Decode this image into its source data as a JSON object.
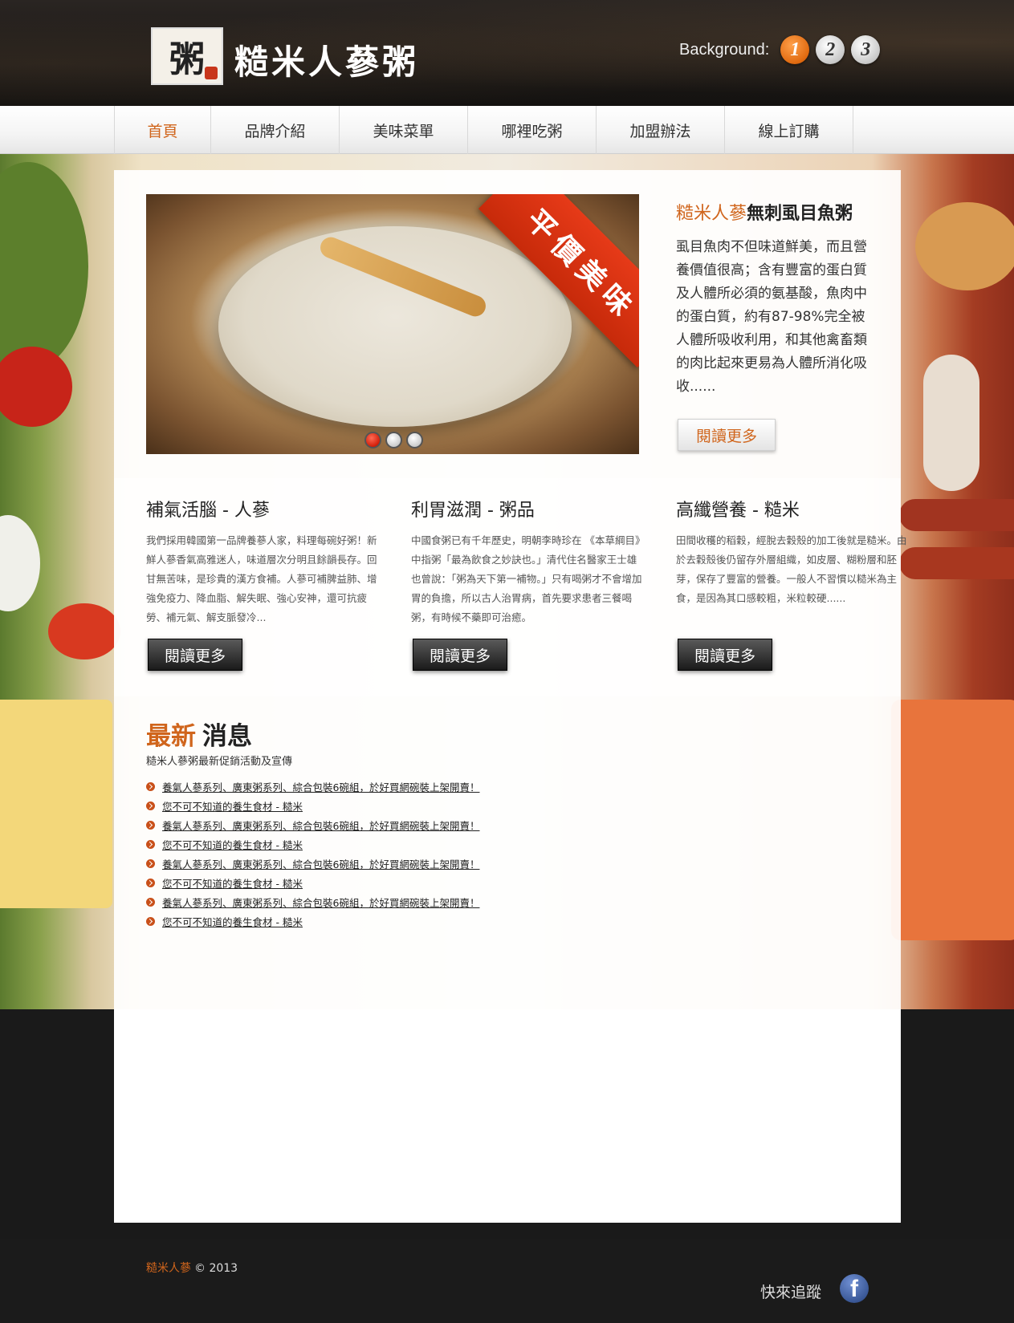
{
  "header": {
    "logo_glyph": "粥",
    "brand": "糙米人蔘粥",
    "background_label": "Background:",
    "background_options": [
      "1",
      "2",
      "3"
    ]
  },
  "nav": {
    "items": [
      "首頁",
      "品牌介紹",
      "美味菜單",
      "哪裡吃粥",
      "加盟辦法",
      "線上訂購"
    ]
  },
  "slider": {
    "ribbon": "平價美味"
  },
  "feature": {
    "title_accent": "糙米人蔘",
    "title_rest": "無刺虱目魚粥",
    "body": "虱目魚肉不但味道鮮美，而且營養價值很高；含有豐富的蛋白質及人體所必須的氨基酸，魚肉中的蛋白質，約有87-98%完全被人體所吸收利用，和其他禽畜類的肉比起來更易為人體所消化吸收......",
    "button": "閱讀更多"
  },
  "columns": [
    {
      "title": "補氣活腦 - 人蔘",
      "body": "我們採用韓國第一品牌養蔘人家，料理每碗好粥！新鮮人蔘香氣高雅迷人，味道層次分明且餘韻長存。回甘無苦味，是珍貴的漢方食補。人蔘可補脾益肺、增強免疫力、降血脂、解失眠、強心安神，還可抗疲勞、補元氣、解支脈發冷...",
      "button": "閱讀更多"
    },
    {
      "title": "利胃滋潤 - 粥品",
      "body": "中國食粥已有千年歷史，明朝李時珍在 《本草綱目》中指粥「最為飲食之妙訣也。」清代住名醫家王士雄也曾說：「粥為天下第一補物。」只有喝粥才不會增加胃的負擔，所以古人治胃病，首先要求患者三餐喝粥，有時候不藥即可治癒。",
      "button": "閱讀更多"
    },
    {
      "title": "高纖營養 - 糙米",
      "body": "田間收穫的稻穀，經脫去穀殼的加工後就是糙米。由於去穀殼後仍留存外層組織，如皮層、糊粉層和胚芽，保存了豐富的營養。一般人不習慣以糙米為主食，是因為其口感較粗，米粒較硬......",
      "button": "閱讀更多"
    }
  ],
  "news": {
    "title_accent": "最新",
    "title_rest": "消息",
    "subtitle": "糙米人蔘粥最新促銷活動及宣傳",
    "items": [
      "養氣人蔘系列、廣東粥系列、綜合包裝6碗組，於好買網碗裝上架開賣！",
      "您不可不知道的養生食材 - 糙米",
      "養氣人蔘系列、廣東粥系列、綜合包裝6碗組，於好買網碗裝上架開賣！",
      "您不可不知道的養生食材 - 糙米",
      "養氣人蔘系列、廣東粥系列、綜合包裝6碗組，於好買網碗裝上架開賣！",
      "您不可不知道的養生食材 - 糙米",
      "養氣人蔘系列、廣東粥系列、綜合包裝6碗組，於好買網碗裝上架開賣！",
      "您不可不知道的養生食材 - 糙米"
    ]
  },
  "footer": {
    "brand": "糙米人蔘",
    "copyright": "© 2013",
    "follow": "快來追蹤",
    "fb_glyph": "f"
  },
  "colors": {
    "accent": "#d0651c",
    "header_bg": "#1b1816",
    "footer_bg": "#1b1b1b",
    "ribbon": "#d52f10",
    "facebook": "#3b5998"
  },
  "icons": [
    "logo-icon",
    "slider-dot-icon",
    "news-bullet-icon",
    "facebook-icon"
  ]
}
